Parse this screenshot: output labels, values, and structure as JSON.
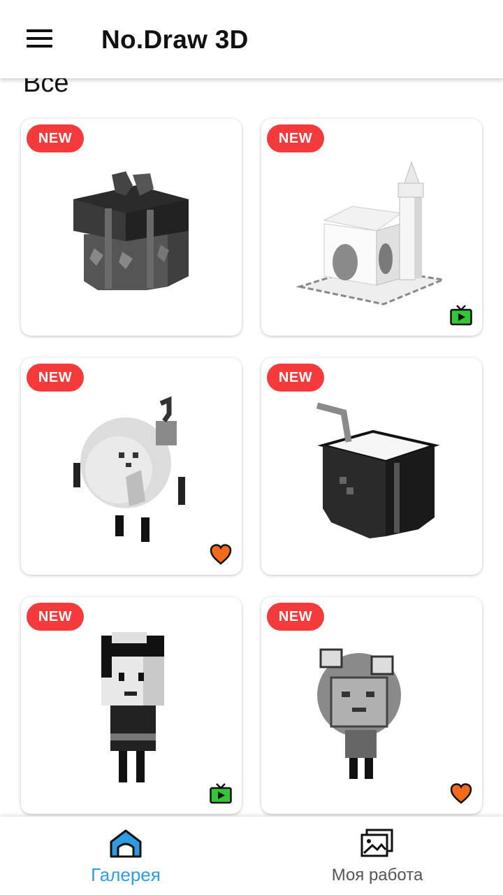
{
  "app": {
    "title": "No.Draw 3D"
  },
  "section": {
    "title": "Все"
  },
  "badge_label": "NEW",
  "gallery": [
    {
      "name": "gift-box",
      "badge": "NEW",
      "extra": "none"
    },
    {
      "name": "mosque",
      "badge": "NEW",
      "extra": "video-ad-icon"
    },
    {
      "name": "round-character",
      "badge": "NEW",
      "extra": "heart-icon"
    },
    {
      "name": "coconut-drink",
      "badge": "NEW",
      "extra": "none"
    },
    {
      "name": "girl-character",
      "badge": "NEW",
      "extra": "video-ad-icon"
    },
    {
      "name": "frog-hood-character",
      "badge": "NEW",
      "extra": "heart-icon"
    }
  ],
  "bottom_nav": {
    "gallery_label": "Галерея",
    "my_work_label": "Моя работа"
  },
  "colors": {
    "badge": "#f43a3a",
    "accent": "#2f9be3",
    "heart": "#f26a1b",
    "video_icon": "#33c639"
  }
}
